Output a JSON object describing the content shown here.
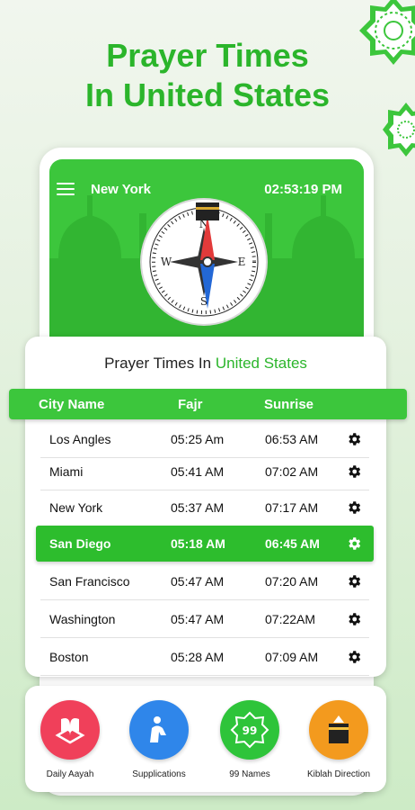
{
  "headline": {
    "line1": "Prayer Times",
    "line2": "In United States"
  },
  "app": {
    "city": "New York",
    "time": "02:53:19 PM"
  },
  "card": {
    "title_prefix": "Prayer Times In ",
    "title_country": "United States"
  },
  "table": {
    "headers": [
      "City Name",
      "Fajr",
      "Sunrise"
    ],
    "rows": [
      {
        "city": "Los Angles",
        "fajr": "05:25 Am",
        "sunrise": "06:53 AM",
        "active": false
      },
      {
        "city": "Miami",
        "fajr": "05:41 AM",
        "sunrise": "07:02 AM",
        "active": false
      },
      {
        "city": "New York",
        "fajr": "05:37 AM",
        "sunrise": "07:17 AM",
        "active": false
      },
      {
        "city": "San Diego",
        "fajr": "05:18 AM",
        "sunrise": "06:45 AM",
        "active": true
      },
      {
        "city": "San Francisco",
        "fajr": "05:47 AM",
        "sunrise": "07:20 AM",
        "active": false
      },
      {
        "city": "Washington",
        "fajr": "05:47 AM",
        "sunrise": "07:22AM",
        "active": false
      },
      {
        "city": "Boston",
        "fajr": "05:28 AM",
        "sunrise": "07:09 AM",
        "active": false
      }
    ]
  },
  "features": [
    {
      "label": "Daily Aayah",
      "icon": "quran-icon",
      "color": "#f0405a"
    },
    {
      "label": "Supplications",
      "icon": "praying-hands-icon",
      "color": "#2f86ea"
    },
    {
      "label": "99 Names",
      "icon": "99-names-icon",
      "color": "#2ec43a"
    },
    {
      "label": "Kiblah Direction",
      "icon": "kaaba-icon",
      "color": "#f39a1e"
    }
  ],
  "colors": {
    "accent": "#3cc63c",
    "headline": "#2bb52b"
  }
}
